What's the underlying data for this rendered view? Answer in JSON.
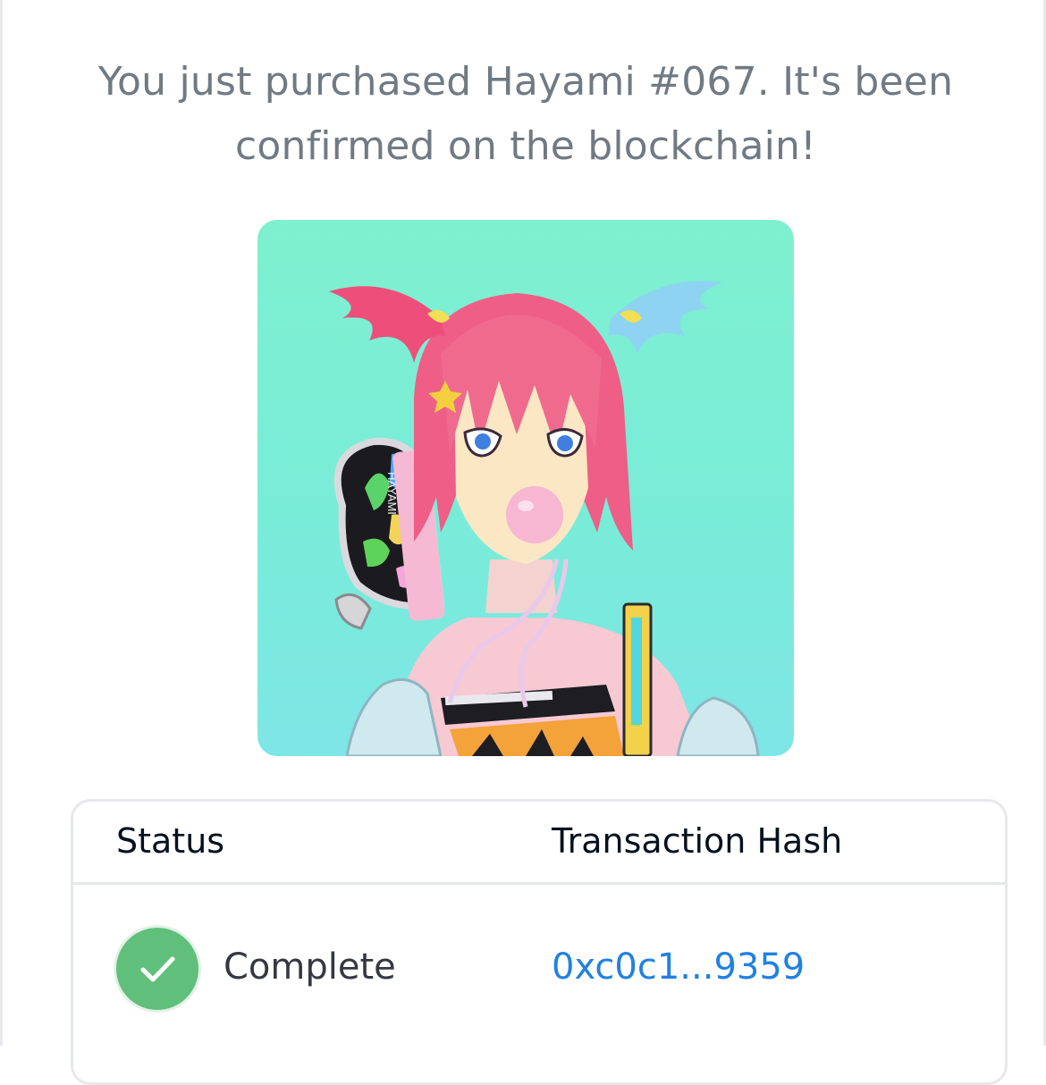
{
  "message": "You just purchased Hayami #067. It's been confirmed on the blockchain!",
  "nft": {
    "image_alt": "Hayami #067",
    "board_text": "HAYAMI"
  },
  "table": {
    "headers": [
      "Status",
      "Transaction Hash"
    ],
    "rows": [
      {
        "status": "Complete",
        "status_icon": "check-icon",
        "hash": "0xc0c1...9359"
      }
    ]
  },
  "colors": {
    "message_text": "#707a83",
    "header_text": "#04111d",
    "status_green": "#5fbf7b",
    "link_blue": "#2081e2",
    "border": "#e6e8eb"
  }
}
